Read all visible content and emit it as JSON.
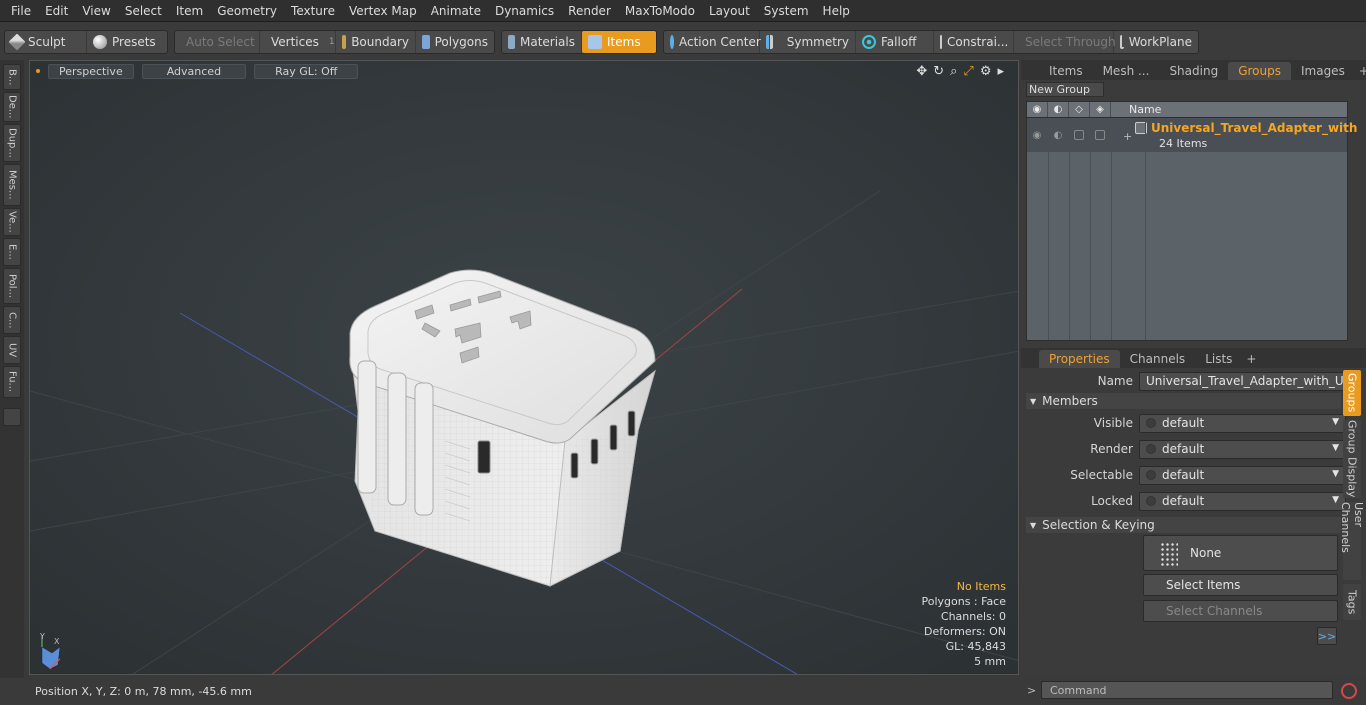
{
  "menu": [
    "File",
    "Edit",
    "View",
    "Select",
    "Item",
    "Geometry",
    "Texture",
    "Vertex Map",
    "Animate",
    "Dynamics",
    "Render",
    "MaxToModo",
    "Layout",
    "System",
    "Help"
  ],
  "toolbar": {
    "sculpt": "Sculpt",
    "presets": "Presets",
    "auto_select": "Auto Select",
    "vertices": "Vertices",
    "vertices_count": "1",
    "boundary": "Boundary",
    "polygons": "Polygons",
    "materials": "Materials",
    "items": "Items",
    "action_center": "Action Center",
    "symmetry": "Symmetry",
    "falloff": "Falloff",
    "constraints": "Constrai...",
    "select_through": "Select Through",
    "workplane": "WorkPlane"
  },
  "left_tabs": [
    "B...",
    "De...",
    "Dup...",
    "Mes...",
    "Ve...",
    "E...",
    "Pol...",
    "C...",
    "UV",
    "Fu..."
  ],
  "viewport": {
    "perspective": "Perspective",
    "advanced": "Advanced",
    "raygl": "Ray GL: Off",
    "info": {
      "items": "No Items",
      "polygons": "Polygons : Face",
      "channels": "Channels: 0",
      "deformers": "Deformers: ON",
      "gl": "GL: 45,843",
      "scale": "5 mm"
    },
    "axis_x": "X",
    "axis_y": "Y"
  },
  "top_tabs": {
    "items": "Items",
    "mesh": "Mesh ...",
    "shading": "Shading",
    "groups": "Groups",
    "images": "Images"
  },
  "groups": {
    "new_group": "New Group",
    "name_header": "Name",
    "group_name": "Universal_Travel_Adapter_with ...",
    "group_count": "24 Items"
  },
  "prop_tabs": {
    "properties": "Properties",
    "channels": "Channels",
    "lists": "Lists"
  },
  "properties": {
    "name_label": "Name",
    "name_value": "Universal_Travel_Adapter_with_USB_",
    "members": "Members",
    "visible_label": "Visible",
    "visible_value": "default",
    "render_label": "Render",
    "render_value": "default",
    "selectable_label": "Selectable",
    "selectable_value": "default",
    "locked_label": "Locked",
    "locked_value": "default",
    "selection_keying": "Selection & Keying",
    "none": "None",
    "select_items": "Select Items",
    "select_channels": "Select Channels",
    "more": ">>"
  },
  "right_vtabs": [
    "Groups",
    "Group Display",
    "User Channels",
    "Tags"
  ],
  "status": {
    "position": "Position X, Y, Z:  0 m, 78 mm, -45.6 mm",
    "command_placeholder": "Command"
  },
  "colors": {
    "accent": "#e89b1e",
    "group_name": "#f5a623"
  }
}
